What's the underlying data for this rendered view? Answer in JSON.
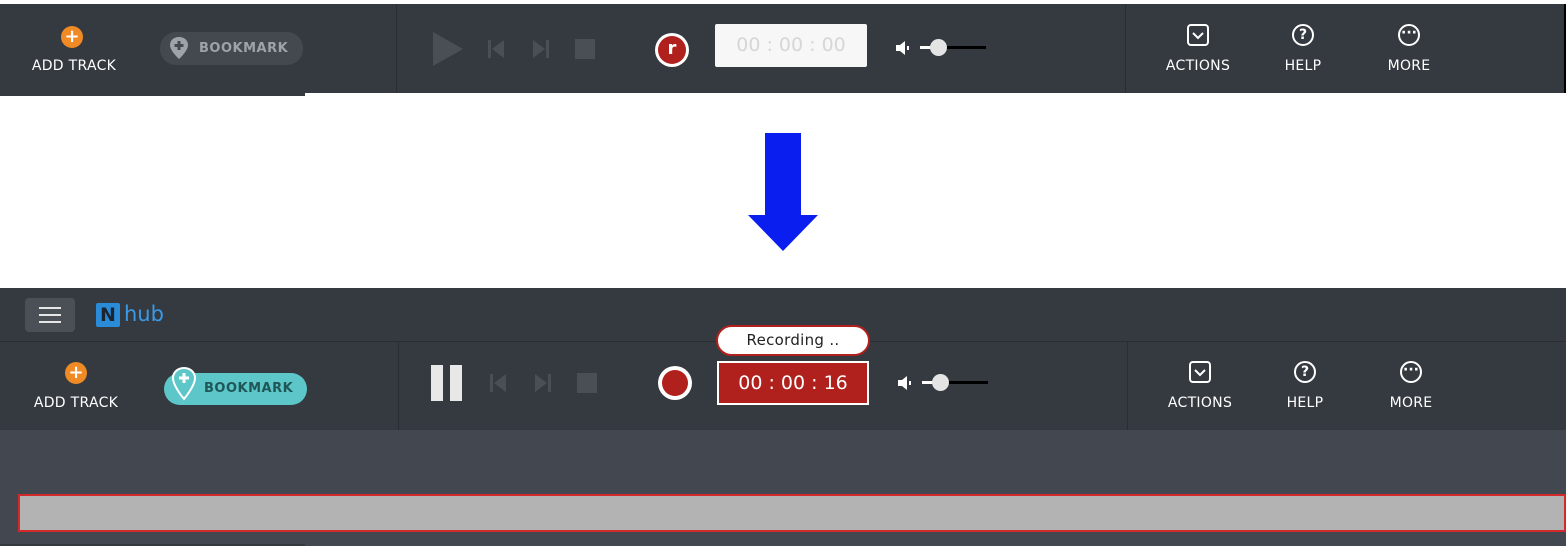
{
  "before": {
    "add_track_label": "ADD TRACK",
    "bookmark_label": "BOOKMARK",
    "timer_value": "00 : 00 : 00",
    "record_letter": "r",
    "actions_label": "ACTIONS",
    "help_label": "HELP",
    "more_label": "MORE"
  },
  "after": {
    "logo_letter": "N",
    "logo_text": "hub",
    "recording_status": "Recording ..",
    "add_track_label": "ADD TRACK",
    "bookmark_label": "BOOKMARK",
    "timer_value": "00 : 00 : 16",
    "actions_label": "ACTIONS",
    "help_label": "HELP",
    "more_label": "MORE"
  },
  "colors": {
    "toolbar_bg": "#353a40",
    "lower_bg": "#434850",
    "accent_orange": "#f08a24",
    "bookmark_teal": "#5cc6c8",
    "record_red": "#b0201c",
    "arrow_blue": "#0a1ef0",
    "logo_blue": "#2a8bd8"
  }
}
